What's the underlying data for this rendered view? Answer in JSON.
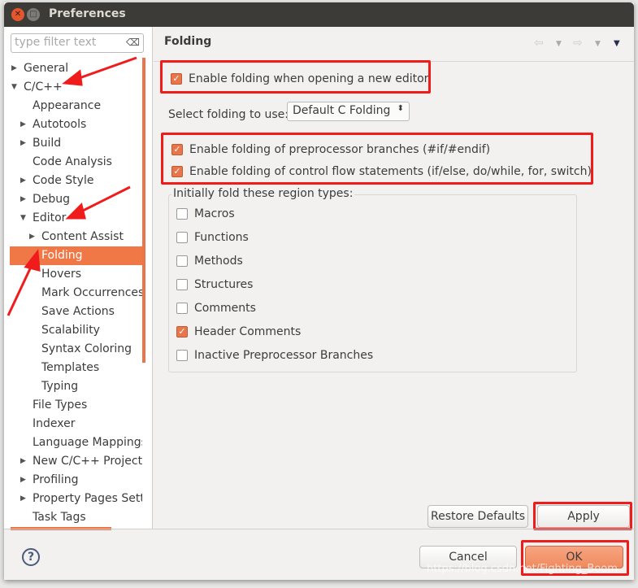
{
  "window": {
    "title": "Preferences"
  },
  "filter": {
    "placeholder": "type filter text"
  },
  "tree": [
    {
      "label": "General",
      "level": 0,
      "arrow": "right"
    },
    {
      "label": "C/C++",
      "level": 0,
      "arrow": "down"
    },
    {
      "label": "Appearance",
      "level": 1,
      "arrow": ""
    },
    {
      "label": "Autotools",
      "level": 1,
      "arrow": "right"
    },
    {
      "label": "Build",
      "level": 1,
      "arrow": "right"
    },
    {
      "label": "Code Analysis",
      "level": 1,
      "arrow": ""
    },
    {
      "label": "Code Style",
      "level": 1,
      "arrow": "right"
    },
    {
      "label": "Debug",
      "level": 1,
      "arrow": "right"
    },
    {
      "label": "Editor",
      "level": 1,
      "arrow": "down"
    },
    {
      "label": "Content Assist",
      "level": 2,
      "arrow": "right"
    },
    {
      "label": "Folding",
      "level": 2,
      "arrow": "",
      "selected": true
    },
    {
      "label": "Hovers",
      "level": 2,
      "arrow": ""
    },
    {
      "label": "Mark Occurrences",
      "level": 2,
      "arrow": ""
    },
    {
      "label": "Save Actions",
      "level": 2,
      "arrow": ""
    },
    {
      "label": "Scalability",
      "level": 2,
      "arrow": ""
    },
    {
      "label": "Syntax Coloring",
      "level": 2,
      "arrow": ""
    },
    {
      "label": "Templates",
      "level": 2,
      "arrow": ""
    },
    {
      "label": "Typing",
      "level": 2,
      "arrow": ""
    },
    {
      "label": "File Types",
      "level": 1,
      "arrow": ""
    },
    {
      "label": "Indexer",
      "level": 1,
      "arrow": ""
    },
    {
      "label": "Language Mappings",
      "level": 1,
      "arrow": ""
    },
    {
      "label": "New C/C++ Project Wizard",
      "level": 1,
      "arrow": "right"
    },
    {
      "label": "Profiling",
      "level": 1,
      "arrow": "right"
    },
    {
      "label": "Property Pages Settings",
      "level": 1,
      "arrow": "right"
    },
    {
      "label": "Task Tags",
      "level": 1,
      "arrow": ""
    }
  ],
  "page": {
    "title": "Folding",
    "enable_folding": {
      "label": "Enable folding when opening a new editor",
      "checked": true
    },
    "select_label": "Select folding to use:",
    "select_value": "Default C Folding",
    "preproc": {
      "label": "Enable folding of preprocessor branches (#if/#endif)",
      "checked": true
    },
    "control": {
      "label": "Enable folding of control flow statements (if/else, do/while, for, switch)",
      "checked": true
    },
    "group_label": "Initially fold these region types:",
    "regions": [
      {
        "label": "Macros",
        "checked": false
      },
      {
        "label": "Functions",
        "checked": false
      },
      {
        "label": "Methods",
        "checked": false
      },
      {
        "label": "Structures",
        "checked": false
      },
      {
        "label": "Comments",
        "checked": false
      },
      {
        "label": "Header Comments",
        "checked": true
      },
      {
        "label": "Inactive Preprocessor Branches",
        "checked": false
      }
    ],
    "restore_label": "Restore Defaults",
    "apply_label": "Apply"
  },
  "footer": {
    "cancel_label": "Cancel",
    "ok_label": "OK"
  },
  "watermark": "https://blog.csdn.net/Fighting_Boom",
  "colors": {
    "accent": "#f07746",
    "annotation": "#f01c1c"
  }
}
